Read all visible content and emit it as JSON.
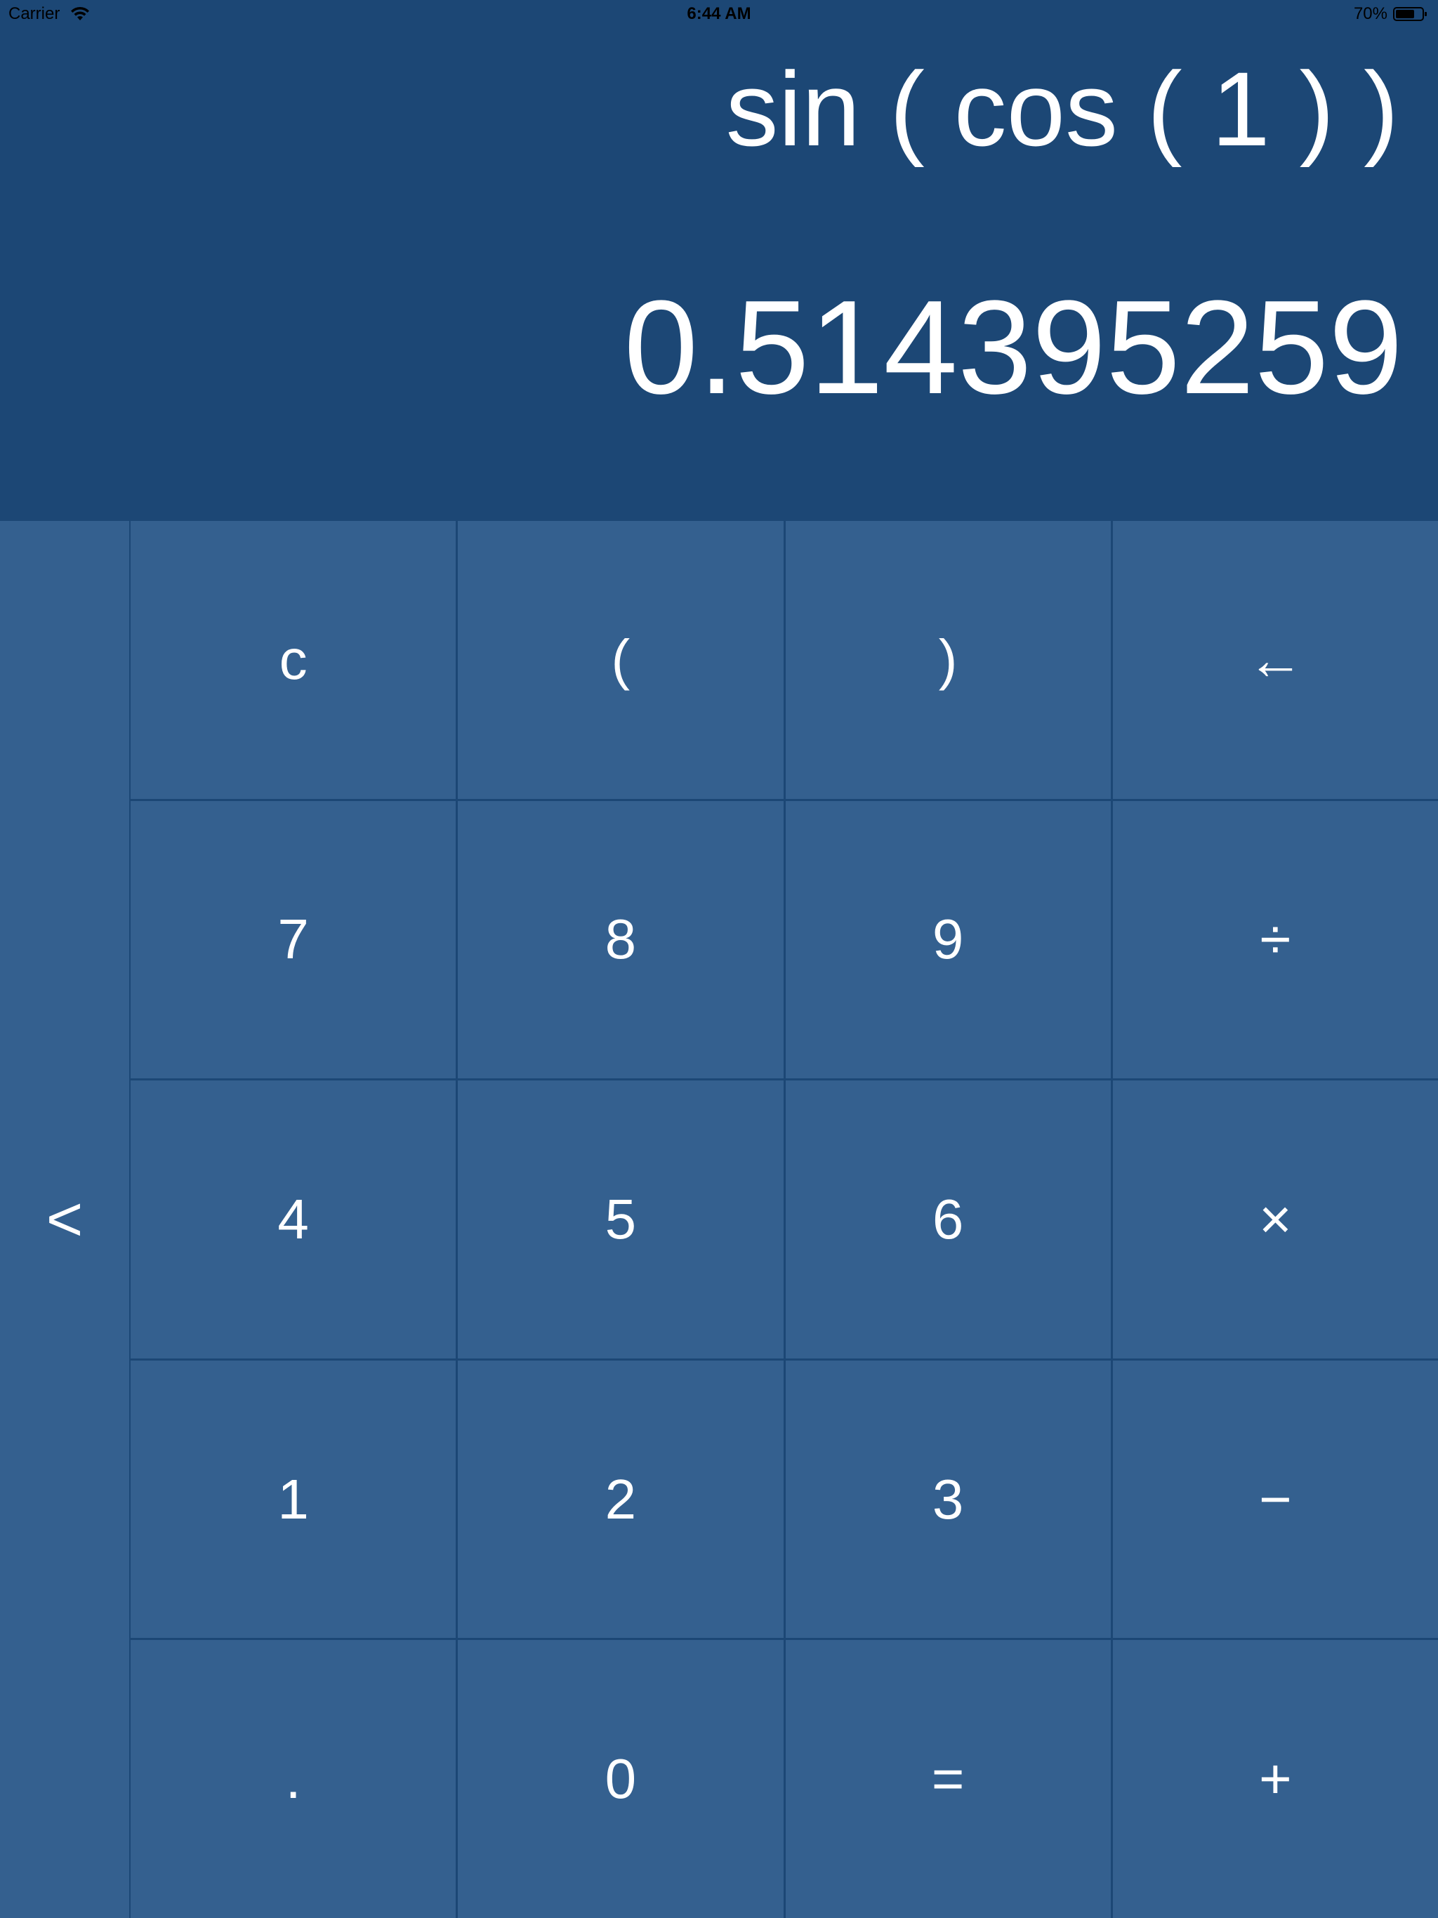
{
  "status_bar": {
    "carrier": "Carrier",
    "time": "6:44 AM",
    "battery": "70%"
  },
  "display": {
    "expression": "sin ( cos ( 1 ) )",
    "result": "0.514395259"
  },
  "keypad": {
    "side_key": "<",
    "keys": [
      {
        "label": "c",
        "name": "clear-button"
      },
      {
        "label": "(",
        "name": "open-paren-button"
      },
      {
        "label": ")",
        "name": "close-paren-button"
      },
      {
        "label": "←",
        "name": "backspace-button"
      },
      {
        "label": "7",
        "name": "digit-7-button"
      },
      {
        "label": "8",
        "name": "digit-8-button"
      },
      {
        "label": "9",
        "name": "digit-9-button"
      },
      {
        "label": "÷",
        "name": "divide-button"
      },
      {
        "label": "4",
        "name": "digit-4-button"
      },
      {
        "label": "5",
        "name": "digit-5-button"
      },
      {
        "label": "6",
        "name": "digit-6-button"
      },
      {
        "label": "×",
        "name": "multiply-button"
      },
      {
        "label": "1",
        "name": "digit-1-button"
      },
      {
        "label": "2",
        "name": "digit-2-button"
      },
      {
        "label": "3",
        "name": "digit-3-button"
      },
      {
        "label": "−",
        "name": "subtract-button"
      },
      {
        "label": ".",
        "name": "decimal-button"
      },
      {
        "label": "0",
        "name": "digit-0-button"
      },
      {
        "label": "=",
        "name": "equals-button"
      },
      {
        "label": "+",
        "name": "add-button"
      }
    ]
  },
  "colors": {
    "background": "#1c4775",
    "key": "#34608f",
    "text": "#ffffff"
  }
}
